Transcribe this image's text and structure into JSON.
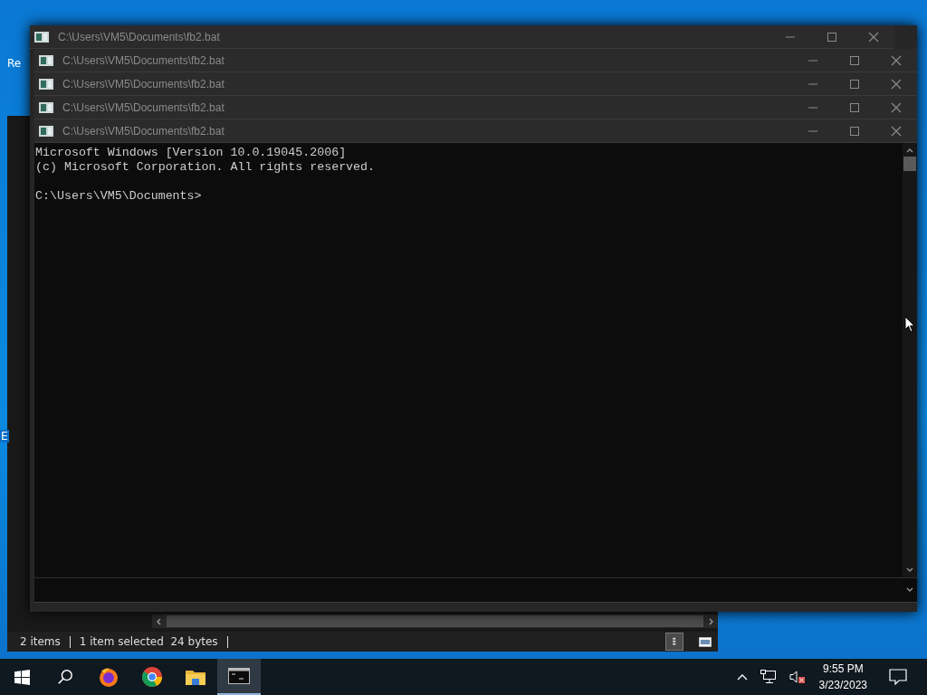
{
  "desktop": {
    "icon_labels": [
      "Re",
      "E"
    ]
  },
  "explorer": {
    "status": [
      "2 items",
      "1 item selected  24 bytes"
    ],
    "view_buttons": [
      {
        "kind": "details",
        "selected": true
      },
      {
        "kind": "tiles",
        "selected": false
      }
    ]
  },
  "console_windows": [
    {
      "title": "C:\\Users\\VM5\\Documents\\fb2.bat"
    },
    {
      "title": "C:\\Users\\VM5\\Documents\\fb2.bat"
    },
    {
      "title": "C:\\Users\\VM5\\Documents\\fb2.bat"
    },
    {
      "title": "C:\\Users\\VM5\\Documents\\fb2.bat"
    },
    {
      "title": "C:\\Users\\VM5\\Documents\\fb2.bat"
    }
  ],
  "console": {
    "output": [
      "Microsoft Windows [Version 10.0.19045.2006]",
      "(c) Microsoft Corporation. All rights reserved."
    ],
    "prompt": "C:\\Users\\VM5\\Documents>"
  },
  "taskbar": {
    "apps": [
      {
        "kind": "firefox",
        "selected": false
      },
      {
        "kind": "chrome",
        "selected": false
      },
      {
        "kind": "folder",
        "selected": false
      },
      {
        "kind": "terminal",
        "selected": true
      }
    ],
    "clock": {
      "time": "9:55 PM",
      "date": "3/23/2023"
    }
  }
}
